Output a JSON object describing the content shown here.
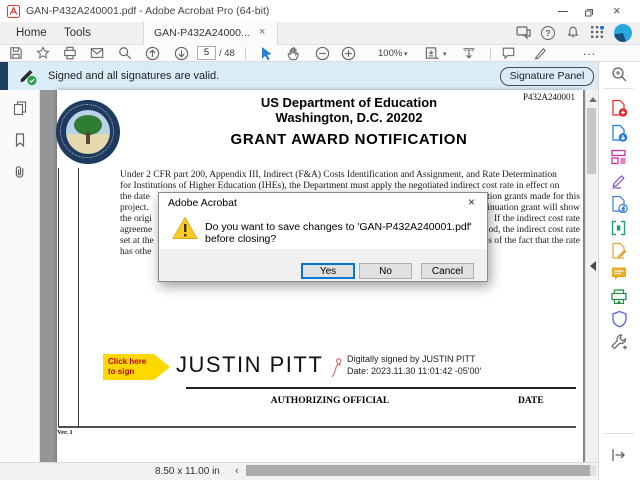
{
  "window": {
    "title": "GAN-P432A240001.pdf - Adobe Acrobat Pro (64-bit)"
  },
  "tab_bar": {
    "home": "Home",
    "tools": "Tools",
    "doc_tab": "GAN-P432A24000...",
    "doc_tab_close": "×",
    "help_glyph": "?"
  },
  "toolbar": {
    "page_current": "5",
    "page_total": "/ 48",
    "zoom_level": "100%",
    "caret": "▾",
    "more": "..."
  },
  "signature_bar": {
    "message": "Signed and all signatures are valid.",
    "panel_button": "Signature Panel"
  },
  "dialog": {
    "title": "Adobe Acrobat",
    "close": "×",
    "message": "Do you want to save changes to 'GAN-P432A240001.pdf' before closing?",
    "yes": "Yes",
    "no": "No",
    "cancel": "Cancel"
  },
  "document": {
    "award_number": "P432A240001",
    "dept_line1": "US Department of Education",
    "dept_line2": "Washington, D.C. 20202",
    "title": "GRANT AWARD NOTIFICATION",
    "body_lines": [
      {
        "left": "Under 2 CFR part 200, Appendix III, Indirect (F&A) Costs Identification and Assignment, and Rate Determination",
        "right": ""
      },
      {
        "left": "for Institutions of Higher Education (IHEs), the Department must apply the negotiated indirect cost rate in effect on",
        "right": ""
      },
      {
        "left": "the date",
        "right": "tion grants made for this"
      },
      {
        "left": "project.",
        "right": "inuation grant will show"
      },
      {
        "left": "the origi",
        "right": "If the indirect cost rate"
      },
      {
        "left": "agreeme",
        "right": "od, the indirect cost rate"
      },
      {
        "left": "set at the",
        "right": "s of the fact that the rate"
      },
      {
        "left": "has othe",
        "right": ""
      }
    ],
    "sign_tag_line1": "Click here",
    "sign_tag_line2": "to sign",
    "signer_name": "JUSTIN PITT",
    "digital_line1": "Digitally signed by JUSTIN PITT",
    "digital_line2": "Date: 2023.11.30 11:01:42 -05'00'",
    "authorizing_label": "AUTHORIZING OFFICIAL",
    "date_label": "DATE",
    "version": "Ver. 1"
  },
  "status_bar": {
    "page_size": "8.50 x 11.00 in",
    "scroll_left_glyph": "‹"
  },
  "colors": {
    "signature_bar_bg": "#d9ecf8",
    "sidebar_strip_navy": "#1d3e5f",
    "acrobat_red": "#e2382e",
    "accent_blue": "#1473e6",
    "warning_yellow": "#ffca28",
    "sign_tag_yellow": "#ffd800",
    "sign_tag_text_red": "#c00000",
    "valid_green": "#27a043"
  }
}
